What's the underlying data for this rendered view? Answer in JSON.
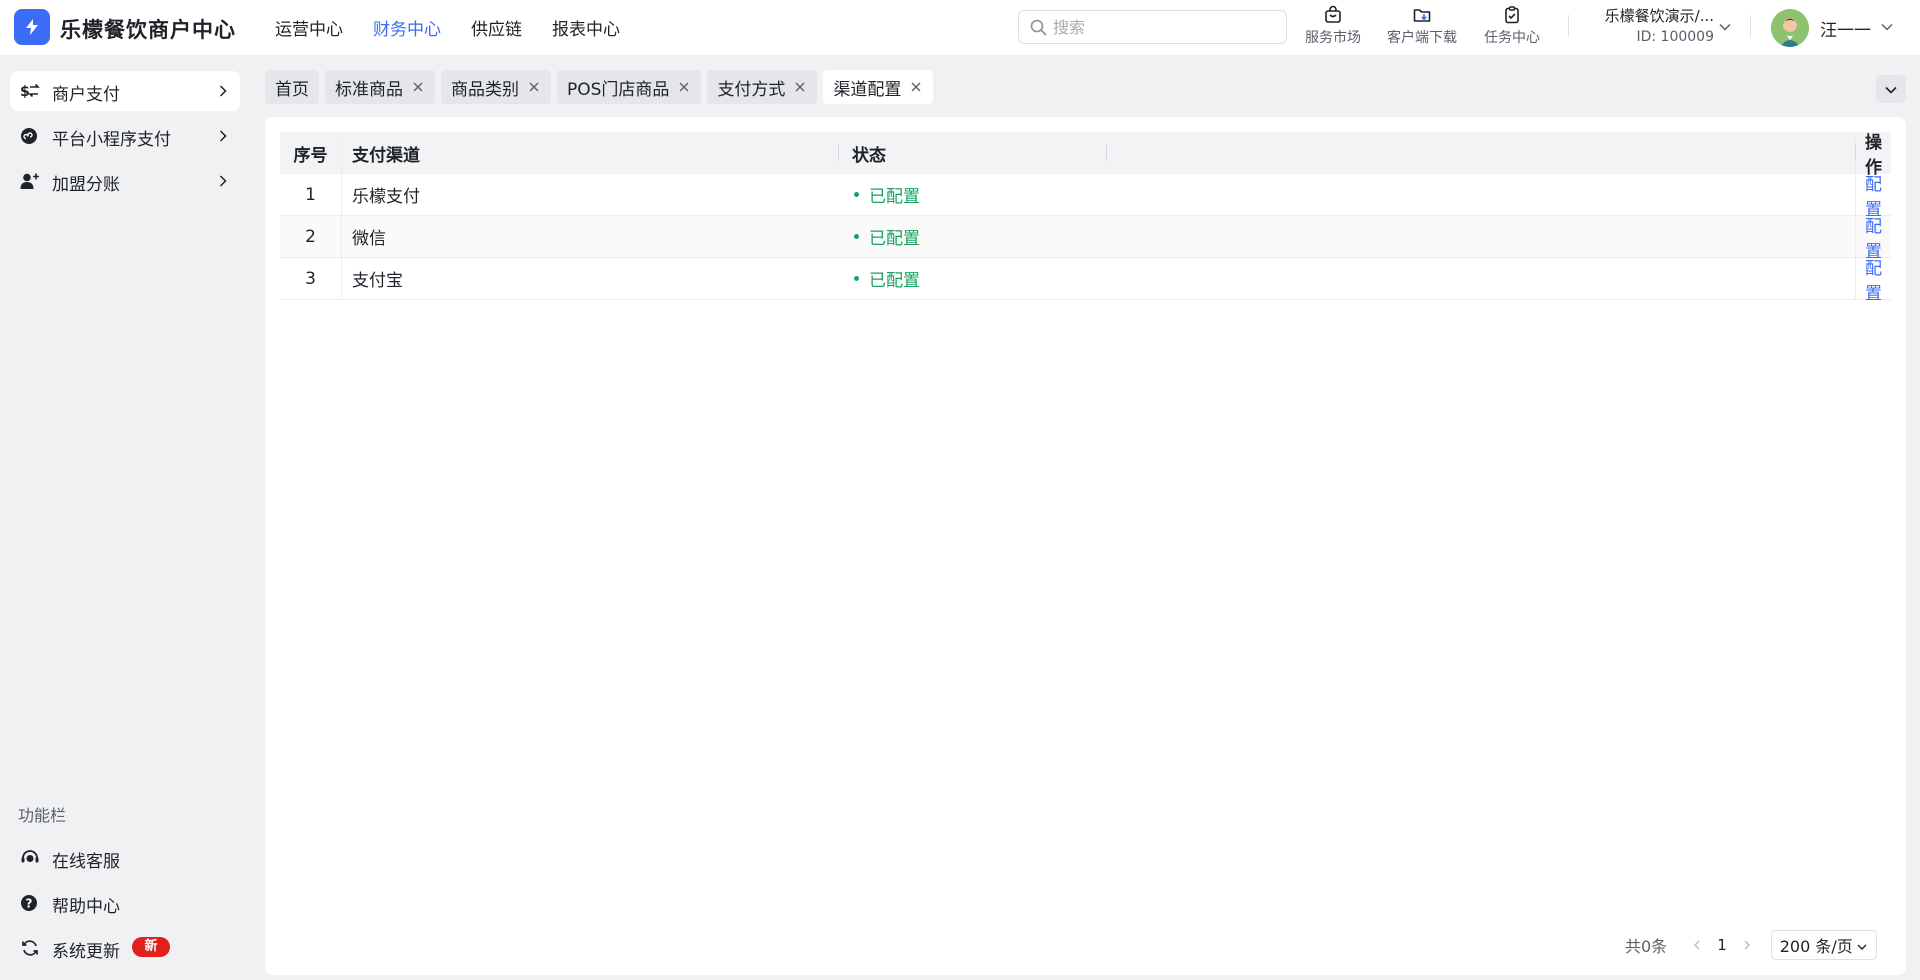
{
  "header": {
    "brand": "乐檬餐饮商户中心",
    "nav": [
      {
        "label": "运营中心",
        "active": false
      },
      {
        "label": "财务中心",
        "active": true
      },
      {
        "label": "供应链",
        "active": false
      },
      {
        "label": "报表中心",
        "active": false
      }
    ],
    "search_placeholder": "搜索",
    "tools": {
      "market": "服务市场",
      "download": "客户端下载",
      "task": "任务中心"
    },
    "store_name": "乐檬餐饮演示/...",
    "store_id": "ID: 100009",
    "user_name": "汪一一"
  },
  "sidebar": {
    "items": [
      {
        "label": "商户支付",
        "icon": "swap-currency-icon",
        "active": true
      },
      {
        "label": "平台小程序支付",
        "icon": "miniprogram-icon",
        "active": false
      },
      {
        "label": "加盟分账",
        "icon": "add-user-icon",
        "active": false
      }
    ],
    "func_title": "功能栏",
    "func_items": [
      {
        "label": "在线客服",
        "icon": "headset-icon"
      },
      {
        "label": "帮助中心",
        "icon": "help-icon"
      },
      {
        "label": "系统更新",
        "icon": "refresh-icon",
        "badge": "新"
      }
    ]
  },
  "tabs": [
    {
      "label": "首页",
      "closable": false,
      "active": false
    },
    {
      "label": "标准商品",
      "closable": true,
      "active": false
    },
    {
      "label": "商品类别",
      "closable": true,
      "active": false
    },
    {
      "label": "POS门店商品",
      "closable": true,
      "active": false
    },
    {
      "label": "支付方式",
      "closable": true,
      "active": false
    },
    {
      "label": "渠道配置",
      "closable": true,
      "active": true
    }
  ],
  "table": {
    "columns": {
      "no": "序号",
      "channel": "支付渠道",
      "status": "状态",
      "action": "操作"
    },
    "rows": [
      {
        "no": "1",
        "channel": "乐檬支付",
        "status": "已配置",
        "action": "配置"
      },
      {
        "no": "2",
        "channel": "微信",
        "status": "已配置",
        "action": "配置"
      },
      {
        "no": "3",
        "channel": "支付宝",
        "status": "已配置",
        "action": "配置"
      }
    ]
  },
  "pagination": {
    "total": "共0条",
    "page": "1",
    "page_size": "200 条/页"
  },
  "colors": {
    "accent": "#3b6cf6",
    "status_ok": "#19a15f",
    "badge_red": "#e0201c"
  }
}
